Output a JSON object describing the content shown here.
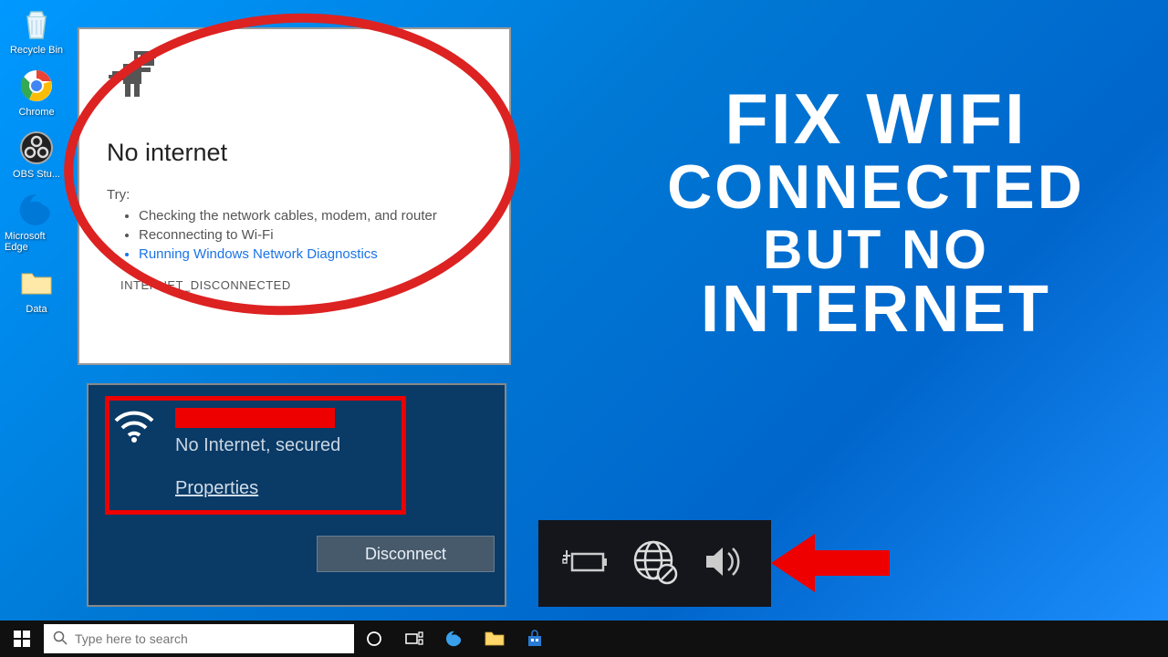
{
  "desktop": {
    "icons": [
      {
        "label": "Recycle Bin",
        "name": "recycle-bin-icon"
      },
      {
        "label": "Chrome",
        "name": "chrome-icon"
      },
      {
        "label": "OBS Stu...",
        "name": "obs-icon"
      },
      {
        "label": "Microsoft Edge",
        "name": "edge-icon"
      },
      {
        "label": "Data",
        "name": "folder-icon"
      }
    ]
  },
  "error_page": {
    "heading": "No internet",
    "try_label": "Try:",
    "suggestions": [
      "Checking the network cables, modem, and router",
      "Reconnecting to Wi-Fi"
    ],
    "diag_link": "Running Windows Network Diagnostics",
    "error_code": "INTERNET_DISCONNECTED"
  },
  "wifi_flyout": {
    "status": "No Internet, secured",
    "properties": "Properties",
    "disconnect": "Disconnect"
  },
  "title": {
    "line1": "FIX  WIFI",
    "line2": "CONNECTED",
    "line3": "BUT NO",
    "line4": "INTERNET"
  },
  "taskbar": {
    "search_placeholder": "Type here to search"
  }
}
